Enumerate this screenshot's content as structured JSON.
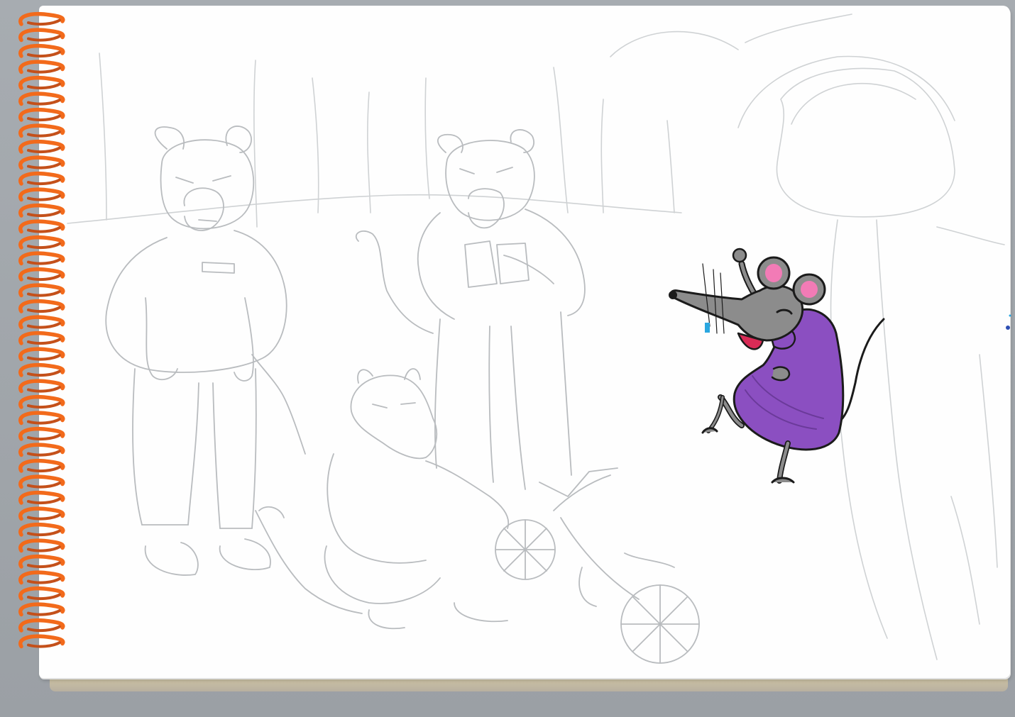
{
  "scene": {
    "colors": {
      "pencil": "#b9bcbf",
      "pencil_dark": "#9c9fa3",
      "spiral": "#f26a1b",
      "paper": "#fefefe",
      "mouse_fur": "#8c8c8c",
      "mouse_dress": "#8b4fc1",
      "mouse_ear": "#f27bb6",
      "outline": "#1b1b1b"
    },
    "icons": [
      "spiral-binding",
      "bear-sketch",
      "rat-sketch",
      "bicycle-sketch",
      "mouse-figure"
    ]
  }
}
